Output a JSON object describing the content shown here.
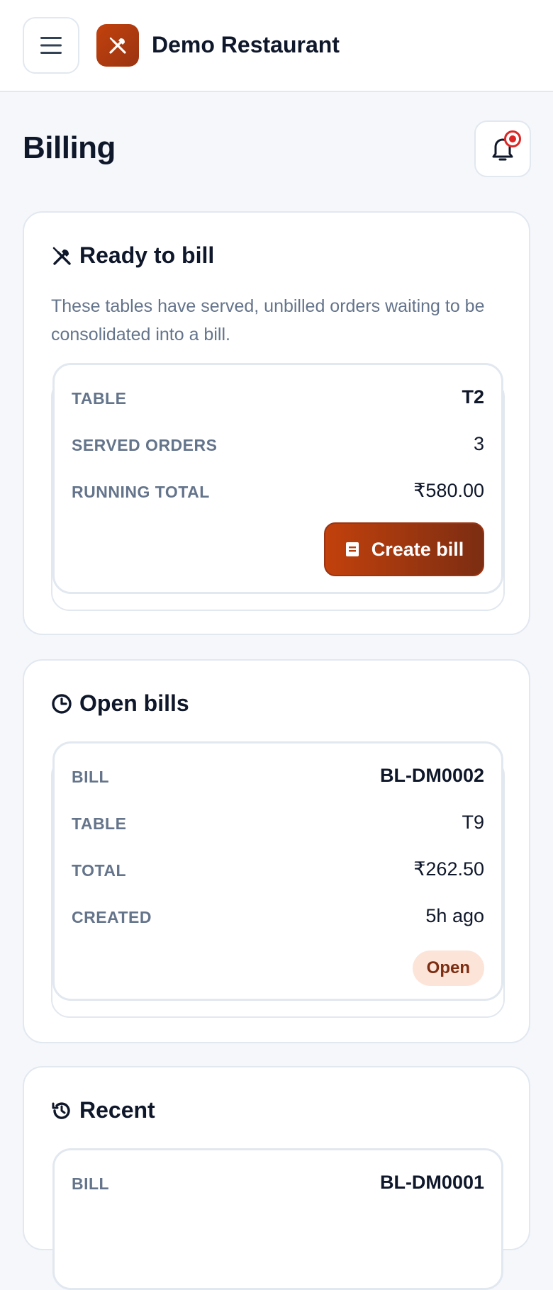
{
  "header": {
    "brand": "Demo Restaurant",
    "accent": "#c2410c"
  },
  "page": {
    "title": "Billing"
  },
  "ready": {
    "title": "Ready to bill",
    "description": "These tables have served, unbilled orders waiting to be consolidated into a bill.",
    "card": {
      "table_label": "TABLE",
      "table_value": "T2",
      "orders_label": "SERVED ORDERS",
      "orders_value": "3",
      "total_label": "RUNNING TOTAL",
      "total_value": "₹580.00",
      "button_label": "Create bill"
    }
  },
  "open": {
    "title": "Open bills",
    "card": {
      "bill_label": "BILL",
      "bill_value": "BL-DM0002",
      "table_label": "TABLE",
      "table_value": "T9",
      "total_label": "TOTAL",
      "total_value": "₹262.50",
      "created_label": "CREATED",
      "created_value": "5h ago",
      "status": "Open"
    }
  },
  "recent": {
    "title": "Recent",
    "card": {
      "bill_label": "BILL",
      "bill_value": "BL-DM0001"
    }
  }
}
